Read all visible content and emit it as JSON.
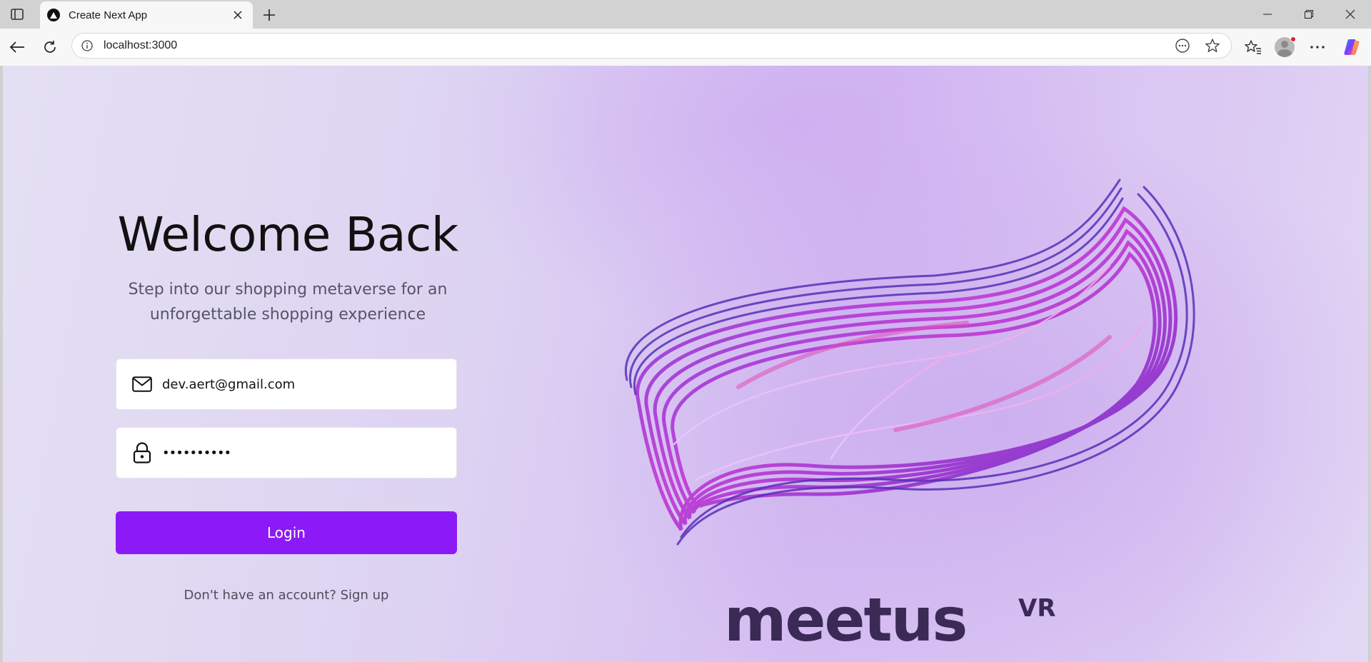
{
  "browser": {
    "tab": {
      "title": "Create Next App",
      "favicon": "nextjs-triangle-icon"
    },
    "address_bar": {
      "url": "localhost:3000"
    },
    "icons": {
      "tab_actions": "tab-actions-icon",
      "close_tab": "close-icon",
      "new_tab": "plus-icon",
      "minimize": "minimize-icon",
      "restore": "restore-icon",
      "close_window": "close-icon",
      "back": "back-arrow-icon",
      "refresh": "refresh-icon",
      "site_info": "info-icon",
      "read_aloud": "more-options-circle-icon",
      "favorite": "star-icon",
      "favorites_list": "favorites-icon",
      "profile": "profile-avatar-icon",
      "settings_more": "ellipsis-icon",
      "copilot": "copilot-icon"
    }
  },
  "page": {
    "title": "Welcome Back",
    "subtitle_line1": "Step into our shopping metaverse for an",
    "subtitle_line2": "unforgettable shopping experience",
    "email": {
      "value": "dev.aert@gmail.com",
      "icon": "mail-icon"
    },
    "password": {
      "masked_value": "••••••••••",
      "icon": "lock-icon"
    },
    "login_button": "Login",
    "signup_prompt": "Don't have an account?",
    "signup_link": "Sign up",
    "brand": {
      "name": "meetus",
      "suffix": "VR"
    },
    "colors": {
      "accent": "#8c1af7",
      "brand_text": "#3a2a55"
    }
  }
}
